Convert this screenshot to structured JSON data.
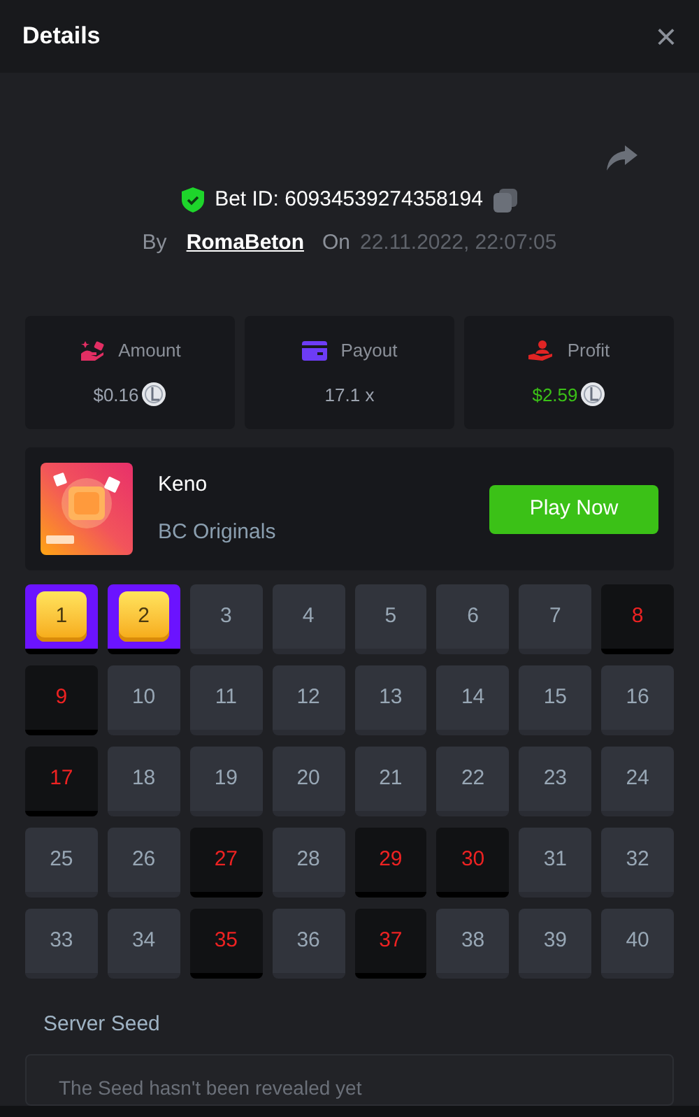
{
  "header": {
    "title": "Details",
    "close": "×"
  },
  "bet": {
    "id": "Bet ID: 60934539274358194",
    "by": "By",
    "user": "RomaBeton",
    "on": "On",
    "date": "22.11.2022, 22:07:05"
  },
  "stats": [
    {
      "kind": "amount",
      "label": "Amount",
      "value": "$0.16",
      "coin": true,
      "color": "#9ca3af"
    },
    {
      "kind": "payout",
      "label": "Payout",
      "value": "17.1 x",
      "coin": false,
      "color": "#9ca3af"
    },
    {
      "kind": "profit",
      "label": "Profit",
      "value": "$2.59",
      "coin": true,
      "color": "#3bc117"
    }
  ],
  "game": {
    "name": "Keno",
    "provider": "BC Originals",
    "button": "Play Now"
  },
  "tiles": [
    {
      "label": "1",
      "kind": "picked"
    },
    {
      "label": "2",
      "kind": "picked"
    },
    {
      "label": "3",
      "kind": "plain"
    },
    {
      "label": "4",
      "kind": "plain"
    },
    {
      "label": "5",
      "kind": "plain"
    },
    {
      "label": "6",
      "kind": "plain"
    },
    {
      "label": "7",
      "kind": "plain"
    },
    {
      "label": "8",
      "kind": "drawn"
    },
    {
      "label": "9",
      "kind": "drawn"
    },
    {
      "label": "10",
      "kind": "plain"
    },
    {
      "label": "11",
      "kind": "plain"
    },
    {
      "label": "12",
      "kind": "plain"
    },
    {
      "label": "13",
      "kind": "plain"
    },
    {
      "label": "14",
      "kind": "plain"
    },
    {
      "label": "15",
      "kind": "plain"
    },
    {
      "label": "16",
      "kind": "plain"
    },
    {
      "label": "17",
      "kind": "drawn"
    },
    {
      "label": "18",
      "kind": "plain"
    },
    {
      "label": "19",
      "kind": "plain"
    },
    {
      "label": "20",
      "kind": "plain"
    },
    {
      "label": "21",
      "kind": "plain"
    },
    {
      "label": "22",
      "kind": "plain"
    },
    {
      "label": "23",
      "kind": "plain"
    },
    {
      "label": "24",
      "kind": "plain"
    },
    {
      "label": "25",
      "kind": "plain"
    },
    {
      "label": "26",
      "kind": "plain"
    },
    {
      "label": "27",
      "kind": "drawn"
    },
    {
      "label": "28",
      "kind": "plain"
    },
    {
      "label": "29",
      "kind": "drawn"
    },
    {
      "label": "30",
      "kind": "drawn"
    },
    {
      "label": "31",
      "kind": "plain"
    },
    {
      "label": "32",
      "kind": "plain"
    },
    {
      "label": "33",
      "kind": "plain"
    },
    {
      "label": "34",
      "kind": "plain"
    },
    {
      "label": "35",
      "kind": "drawn"
    },
    {
      "label": "36",
      "kind": "plain"
    },
    {
      "label": "37",
      "kind": "drawn"
    },
    {
      "label": "38",
      "kind": "plain"
    },
    {
      "label": "39",
      "kind": "plain"
    },
    {
      "label": "40",
      "kind": "plain"
    }
  ],
  "server_seed": {
    "label": "Server Seed",
    "text": "The Seed hasn't been revealed yet"
  }
}
